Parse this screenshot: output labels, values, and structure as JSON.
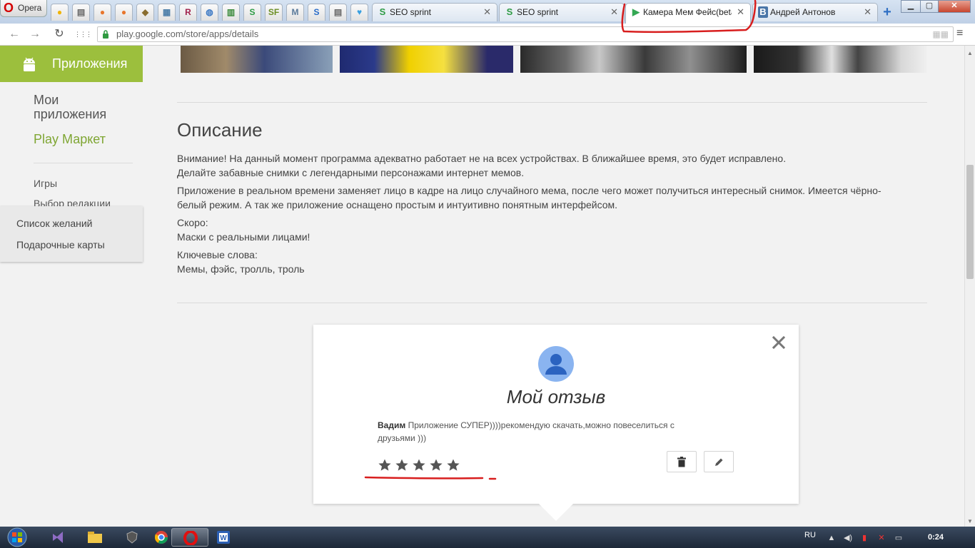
{
  "browser": {
    "menu_label": "Opera",
    "pinned_tabs": [
      {
        "icon": "egg-icon",
        "glyph": "●",
        "color": "#f0b400"
      },
      {
        "icon": "document-icon",
        "glyph": "▤",
        "color": "#666666"
      },
      {
        "icon": "peach-icon",
        "glyph": "●",
        "color": "#e8762c"
      },
      {
        "icon": "peach-icon",
        "glyph": "●",
        "color": "#e8762c"
      },
      {
        "icon": "pharaoh-icon",
        "glyph": "◆",
        "color": "#8a6d2f"
      },
      {
        "icon": "grid-map-icon",
        "glyph": "▦",
        "color": "#4a7da8"
      },
      {
        "icon": "r-letter-icon",
        "glyph": "R",
        "color": "#a0204a"
      },
      {
        "icon": "globe-icon",
        "glyph": "◍",
        "color": "#3b78c4"
      },
      {
        "icon": "bar-chart-icon",
        "glyph": "▥",
        "color": "#3a8a3a"
      },
      {
        "icon": "seo-s-icon",
        "glyph": "S",
        "color": "#2e9b45"
      },
      {
        "icon": "sf-icon",
        "glyph": "SF",
        "color": "#6b8e23"
      },
      {
        "icon": "m-letter-icon",
        "glyph": "M",
        "color": "#5a7a9a"
      },
      {
        "icon": "s-box-icon",
        "glyph": "S",
        "color": "#2a6cc8"
      },
      {
        "icon": "document-icon",
        "glyph": "▤",
        "color": "#666666"
      },
      {
        "icon": "heart-icon",
        "glyph": "♥",
        "color": "#3aa0e0"
      }
    ],
    "tabs": [
      {
        "label": "SEO sprint",
        "favicon": "S",
        "close": "✕"
      },
      {
        "label": "SEO sprint",
        "favicon": "S",
        "close": "✕"
      },
      {
        "label": "Камера Мем Фейс(beta)",
        "favicon": "▶",
        "close": "✕"
      },
      {
        "label": "Андрей Антонов",
        "favicon": "В",
        "close": "✕"
      }
    ],
    "new_tab": "+",
    "window_buttons": {
      "minimize": "▁",
      "maximize": "▢",
      "close": "✕"
    },
    "nav": {
      "back": "←",
      "forward": "→",
      "reload": "↻",
      "apps": "⋮⋮⋮"
    },
    "url": "play.google.com/store/apps/details",
    "reader": "▦▦"
  },
  "sidebar": {
    "header": "Приложения",
    "my_apps": "Мои приложения",
    "play_market": "Play Маркет",
    "games": "Игры",
    "editors_choice": "Выбор редакции",
    "wishlist": "Список желаний",
    "gift_cards": "Подарочные карты"
  },
  "description": {
    "title": "Описание",
    "p1_line1": "Внимание! На данный момент программа адекватно работает не на всех устройствах. В ближайшее время, это будет исправлено.",
    "p1_line2": "Делайте забавные снимки с легендарными персонажами интернет мемов.",
    "p2": "Приложение в реальном времени заменяет лицо в кадре на лицо случайного мема, после чего может получиться интересный снимок. Имеется чёрно-белый режим. А так же приложение оснащено простым и интуитивно понятным интерфейсом.",
    "soon_label": "Скоро:",
    "soon_text": "Маски с реальными лицами!",
    "keywords_label": "Ключевые слова:",
    "keywords": "Мемы, фэйс, тролль, троль"
  },
  "review": {
    "title": "Мой отзыв",
    "reviewer": "Вадим",
    "text": "Приложение СУПЕР))))рекомендую скачать,можно повеселиться с друзьями )))",
    "rating": 5,
    "max_rating": 5
  },
  "taskbar": {
    "language": "RU",
    "clock": "0:24"
  }
}
